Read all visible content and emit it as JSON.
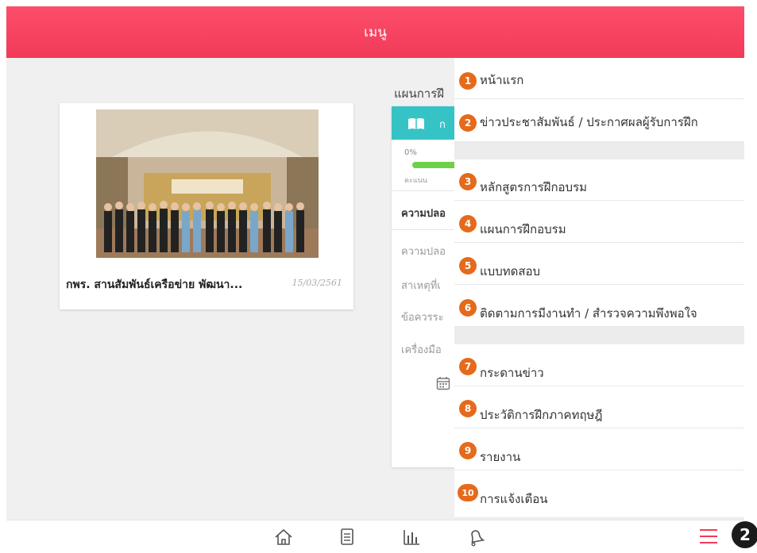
{
  "header": {
    "title": "เมนู"
  },
  "news": {
    "title": "กพร. สานสัมพันธ์เครือข่าย พัฒนา...",
    "date": "15/03/2561"
  },
  "plan": {
    "title": "แผนการฝึ",
    "head_label": "ก",
    "percent_label": "0%",
    "progress": 0,
    "score_label": "คะแนน",
    "rows": [
      "ความปลอ",
      "ความปลอ",
      "สาเหตุที่เ",
      "ข้อควรระ",
      "เครื่องมือ"
    ]
  },
  "menu": {
    "items": [
      {
        "num": "1",
        "label": "หน้าแรก"
      },
      {
        "num": "2",
        "label": "ข่าวประชาสัมพันธ์ / ประกาศผลผู้รับการฝึก"
      },
      {
        "num": "3",
        "label": "หลักสูตรการฝึกอบรม"
      },
      {
        "num": "4",
        "label": "แผนการฝึกอบรม"
      },
      {
        "num": "5",
        "label": "แบบทดสอบ"
      },
      {
        "num": "6",
        "label": "ติดตามการมีงานทำ / สำรวจความพึงพอใจ"
      },
      {
        "num": "7",
        "label": "กระดานข่าว"
      },
      {
        "num": "8",
        "label": "ประวัติการฝึกภาคทฤษฎี"
      },
      {
        "num": "9",
        "label": "รายงาน"
      },
      {
        "num": "10",
        "label": "การแจ้งเตือน"
      }
    ]
  },
  "bottom_nav": {
    "icons": [
      "home-icon",
      "document-icon",
      "chart-icon",
      "bell-icon",
      "menu-icon"
    ],
    "callout": "2"
  },
  "colors": {
    "header": "#f23a59",
    "badge": "#e56a1b",
    "teal": "#35c3c6",
    "progress": "#6fd04a"
  }
}
